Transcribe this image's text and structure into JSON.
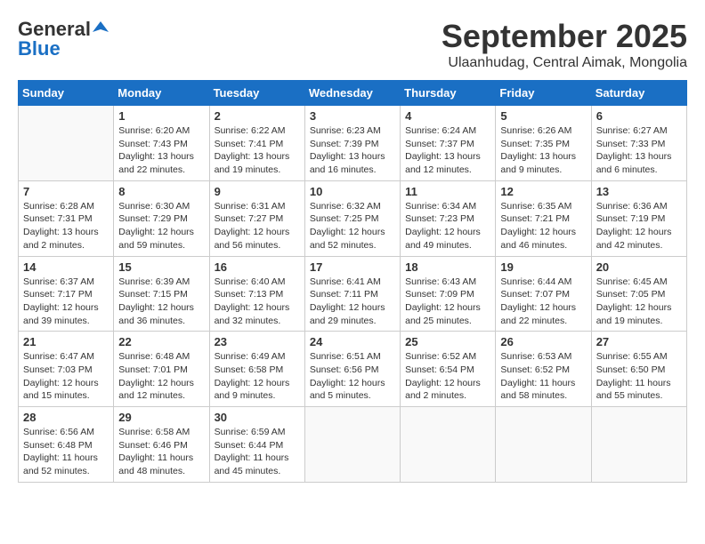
{
  "logo": {
    "general": "General",
    "blue": "Blue"
  },
  "title": "September 2025",
  "subtitle": "Ulaanhudag, Central Aimak, Mongolia",
  "headers": [
    "Sunday",
    "Monday",
    "Tuesday",
    "Wednesday",
    "Thursday",
    "Friday",
    "Saturday"
  ],
  "days": [
    {
      "num": "",
      "info": ""
    },
    {
      "num": "1",
      "info": "Sunrise: 6:20 AM\nSunset: 7:43 PM\nDaylight: 13 hours\nand 22 minutes."
    },
    {
      "num": "2",
      "info": "Sunrise: 6:22 AM\nSunset: 7:41 PM\nDaylight: 13 hours\nand 19 minutes."
    },
    {
      "num": "3",
      "info": "Sunrise: 6:23 AM\nSunset: 7:39 PM\nDaylight: 13 hours\nand 16 minutes."
    },
    {
      "num": "4",
      "info": "Sunrise: 6:24 AM\nSunset: 7:37 PM\nDaylight: 13 hours\nand 12 minutes."
    },
    {
      "num": "5",
      "info": "Sunrise: 6:26 AM\nSunset: 7:35 PM\nDaylight: 13 hours\nand 9 minutes."
    },
    {
      "num": "6",
      "info": "Sunrise: 6:27 AM\nSunset: 7:33 PM\nDaylight: 13 hours\nand 6 minutes."
    },
    {
      "num": "7",
      "info": "Sunrise: 6:28 AM\nSunset: 7:31 PM\nDaylight: 13 hours\nand 2 minutes."
    },
    {
      "num": "8",
      "info": "Sunrise: 6:30 AM\nSunset: 7:29 PM\nDaylight: 12 hours\nand 59 minutes."
    },
    {
      "num": "9",
      "info": "Sunrise: 6:31 AM\nSunset: 7:27 PM\nDaylight: 12 hours\nand 56 minutes."
    },
    {
      "num": "10",
      "info": "Sunrise: 6:32 AM\nSunset: 7:25 PM\nDaylight: 12 hours\nand 52 minutes."
    },
    {
      "num": "11",
      "info": "Sunrise: 6:34 AM\nSunset: 7:23 PM\nDaylight: 12 hours\nand 49 minutes."
    },
    {
      "num": "12",
      "info": "Sunrise: 6:35 AM\nSunset: 7:21 PM\nDaylight: 12 hours\nand 46 minutes."
    },
    {
      "num": "13",
      "info": "Sunrise: 6:36 AM\nSunset: 7:19 PM\nDaylight: 12 hours\nand 42 minutes."
    },
    {
      "num": "14",
      "info": "Sunrise: 6:37 AM\nSunset: 7:17 PM\nDaylight: 12 hours\nand 39 minutes."
    },
    {
      "num": "15",
      "info": "Sunrise: 6:39 AM\nSunset: 7:15 PM\nDaylight: 12 hours\nand 36 minutes."
    },
    {
      "num": "16",
      "info": "Sunrise: 6:40 AM\nSunset: 7:13 PM\nDaylight: 12 hours\nand 32 minutes."
    },
    {
      "num": "17",
      "info": "Sunrise: 6:41 AM\nSunset: 7:11 PM\nDaylight: 12 hours\nand 29 minutes."
    },
    {
      "num": "18",
      "info": "Sunrise: 6:43 AM\nSunset: 7:09 PM\nDaylight: 12 hours\nand 25 minutes."
    },
    {
      "num": "19",
      "info": "Sunrise: 6:44 AM\nSunset: 7:07 PM\nDaylight: 12 hours\nand 22 minutes."
    },
    {
      "num": "20",
      "info": "Sunrise: 6:45 AM\nSunset: 7:05 PM\nDaylight: 12 hours\nand 19 minutes."
    },
    {
      "num": "21",
      "info": "Sunrise: 6:47 AM\nSunset: 7:03 PM\nDaylight: 12 hours\nand 15 minutes."
    },
    {
      "num": "22",
      "info": "Sunrise: 6:48 AM\nSunset: 7:01 PM\nDaylight: 12 hours\nand 12 minutes."
    },
    {
      "num": "23",
      "info": "Sunrise: 6:49 AM\nSunset: 6:58 PM\nDaylight: 12 hours\nand 9 minutes."
    },
    {
      "num": "24",
      "info": "Sunrise: 6:51 AM\nSunset: 6:56 PM\nDaylight: 12 hours\nand 5 minutes."
    },
    {
      "num": "25",
      "info": "Sunrise: 6:52 AM\nSunset: 6:54 PM\nDaylight: 12 hours\nand 2 minutes."
    },
    {
      "num": "26",
      "info": "Sunrise: 6:53 AM\nSunset: 6:52 PM\nDaylight: 11 hours\nand 58 minutes."
    },
    {
      "num": "27",
      "info": "Sunrise: 6:55 AM\nSunset: 6:50 PM\nDaylight: 11 hours\nand 55 minutes."
    },
    {
      "num": "28",
      "info": "Sunrise: 6:56 AM\nSunset: 6:48 PM\nDaylight: 11 hours\nand 52 minutes."
    },
    {
      "num": "29",
      "info": "Sunrise: 6:58 AM\nSunset: 6:46 PM\nDaylight: 11 hours\nand 48 minutes."
    },
    {
      "num": "30",
      "info": "Sunrise: 6:59 AM\nSunset: 6:44 PM\nDaylight: 11 hours\nand 45 minutes."
    },
    {
      "num": "",
      "info": ""
    },
    {
      "num": "",
      "info": ""
    },
    {
      "num": "",
      "info": ""
    },
    {
      "num": "",
      "info": ""
    }
  ]
}
